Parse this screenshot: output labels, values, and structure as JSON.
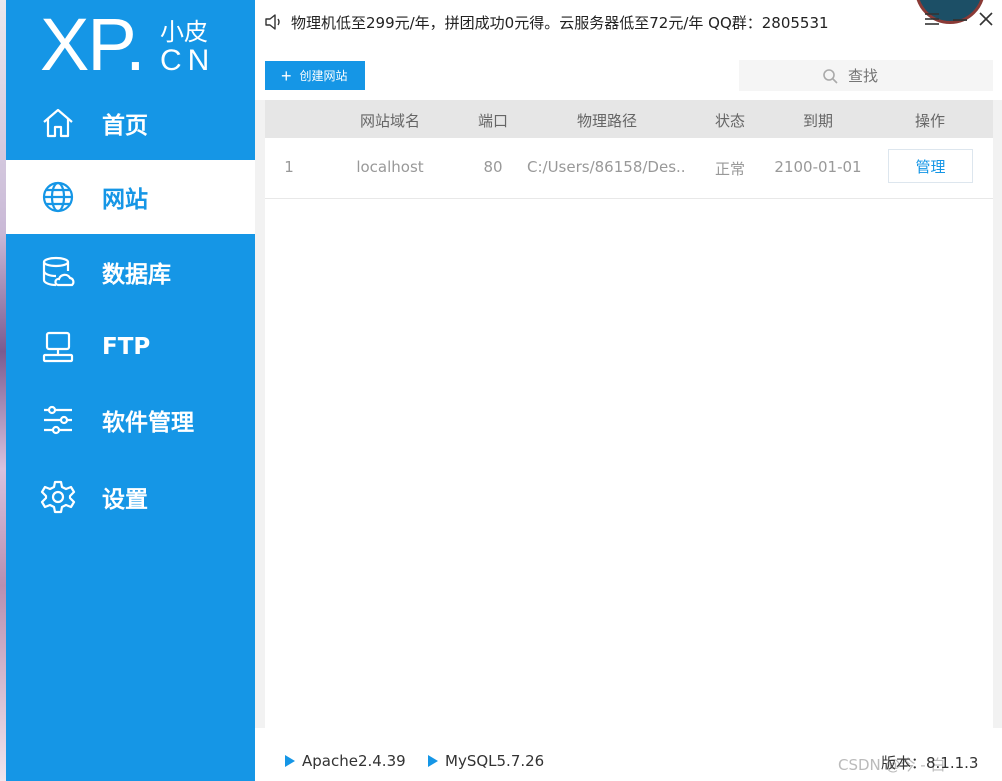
{
  "brand": {
    "logo_main": "XP.",
    "logo_cn_small": "小皮",
    "logo_cn_big": "CN"
  },
  "sidebar": {
    "items": [
      {
        "label": "首页",
        "icon": "home-icon",
        "active": false
      },
      {
        "label": "网站",
        "icon": "globe-icon",
        "active": true
      },
      {
        "label": "数据库",
        "icon": "database-icon",
        "active": false
      },
      {
        "label": "FTP",
        "icon": "ftp-server-icon",
        "active": false
      },
      {
        "label": "软件管理",
        "icon": "sliders-icon",
        "active": false
      },
      {
        "label": "设置",
        "icon": "gear-icon",
        "active": false
      }
    ]
  },
  "topbar": {
    "notice": "物理机低至299元/年，拼团成功0元得。云服务器低至72元/年  QQ群：2805531"
  },
  "toolbar": {
    "create_label": "创建网站",
    "search_placeholder": "查找"
  },
  "table": {
    "columns": [
      "",
      "网站域名",
      "端口",
      "物理路径",
      "状态",
      "到期",
      "操作"
    ],
    "rows": [
      {
        "index": "1",
        "domain": "localhost",
        "port": "80",
        "path": "C:/Users/86158/Des...",
        "status": "正常",
        "expiry": "2100-01-01",
        "action": "管理"
      }
    ]
  },
  "statusbar": {
    "services": [
      "Apache2.4.39",
      "MySQL5.7.26"
    ],
    "version": "版本：8.1.1.3",
    "watermark": "CSDN @今 - 白"
  },
  "colors": {
    "accent": "#1596e6",
    "sidebar_active_bg": "#ffffff",
    "header_bg": "#e6e6e6"
  }
}
